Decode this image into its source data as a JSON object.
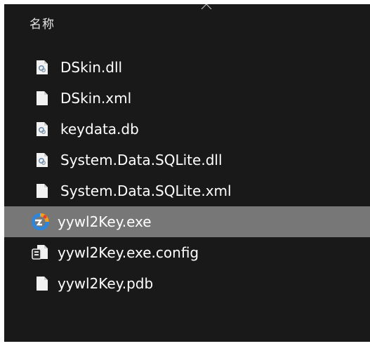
{
  "header": {
    "name_column": "名称"
  },
  "files": [
    {
      "name": "DSkin.dll",
      "icon": "dll-file-icon"
    },
    {
      "name": "DSkin.xml",
      "icon": "blank-file-icon"
    },
    {
      "name": "keydata.db",
      "icon": "dll-file-icon"
    },
    {
      "name": "System.Data.SQLite.dll",
      "icon": "dll-file-icon"
    },
    {
      "name": "System.Data.SQLite.xml",
      "icon": "blank-file-icon"
    },
    {
      "name": "yywl2Key.exe",
      "icon": "app-exe-icon",
      "selected": true
    },
    {
      "name": "yywl2Key.exe.config",
      "icon": "config-file-icon"
    },
    {
      "name": "yywl2Key.pdb",
      "icon": "blank-file-icon"
    }
  ],
  "colors": {
    "background": "#191919",
    "selection": "#777777",
    "text": "#ffffff",
    "header_text": "#e6e6e6"
  }
}
